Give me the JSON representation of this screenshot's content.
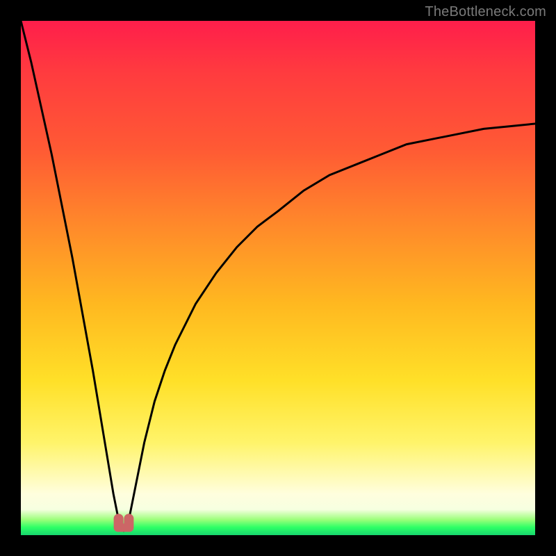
{
  "watermark": "TheBottleneck.com",
  "colors": {
    "frame": "#000000",
    "curve_stroke": "#000000",
    "marker_fill": "#cc6666",
    "gradient_top": "#ff1e4b",
    "gradient_bottom": "#17d66e"
  },
  "chart_data": {
    "type": "line",
    "title": "",
    "xlabel": "",
    "ylabel": "",
    "xlim": [
      0,
      100
    ],
    "ylim": [
      0,
      100
    ],
    "grid": false,
    "legend": false,
    "notes": "Bottleneck curve: value ≈ 0 at x≈20 (optimum), rises steeply toward 100 as x→0, and rises with diminishing slope toward ~80 as x→100. Background gradient maps y to severity: green ≈ 0, yellow ≈ 40–60, red ≈ 90–100.",
    "series": [
      {
        "name": "bottleneck-curve",
        "x": [
          0,
          2,
          4,
          6,
          8,
          10,
          12,
          14,
          16,
          18,
          19,
          20,
          21,
          22,
          24,
          26,
          28,
          30,
          34,
          38,
          42,
          46,
          50,
          55,
          60,
          65,
          70,
          75,
          80,
          85,
          90,
          95,
          100
        ],
        "values": [
          100,
          92,
          83,
          74,
          64,
          54,
          43,
          32,
          20,
          8,
          3,
          1,
          3,
          8,
          18,
          26,
          32,
          37,
          45,
          51,
          56,
          60,
          63,
          67,
          70,
          72,
          74,
          76,
          77,
          78,
          79,
          79.5,
          80
        ]
      }
    ],
    "markers": [
      {
        "name": "optimum-min-left",
        "x": 19,
        "y": 2
      },
      {
        "name": "optimum-min-right",
        "x": 21,
        "y": 2
      }
    ]
  }
}
